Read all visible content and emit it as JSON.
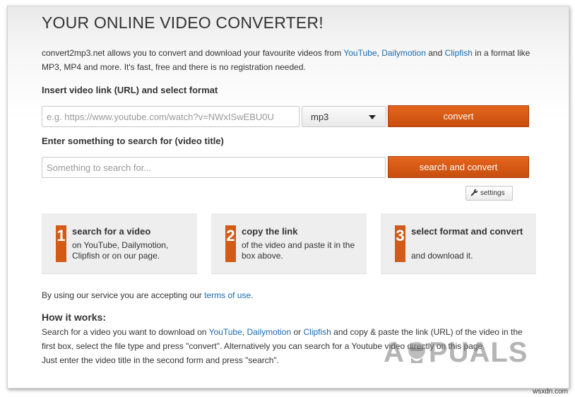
{
  "header": {
    "title": "YOUR ONLINE VIDEO CONVERTER!"
  },
  "intro": {
    "text1": "convert2mp3.net allows you to convert and download your favourite videos from ",
    "link1": "YouTube",
    "sep1": ", ",
    "link2": "Dailymotion",
    "sep2": " and ",
    "link3": "Clipfish",
    "text2": " in a format like MP3, MP4 and more. It's fast, free and there is no registration needed."
  },
  "url_form": {
    "label": "Insert video link (URL) and select format",
    "placeholder": "e.g. https://www.youtube.com/watch?v=NWxISwEBU0U",
    "format_value": "mp3",
    "convert_label": "convert"
  },
  "search_form": {
    "label": "Enter something to search for (video title)",
    "placeholder": "Something to search for...",
    "button_label": "search and convert"
  },
  "settings": {
    "label": "settings",
    "icon": "wrench-icon"
  },
  "steps": [
    {
      "number": "1",
      "title": "search for a video",
      "desc": "on YouTube, Dailymotion, Clipfish or on our page."
    },
    {
      "number": "2",
      "title": "copy the link",
      "desc": "of the video and paste it in the box above."
    },
    {
      "number": "3",
      "title": "select format and convert",
      "desc": "and download it."
    }
  ],
  "terms": {
    "text": "By using our service you are accepting our ",
    "link": "terms of use",
    "end": "."
  },
  "how": {
    "title": "How it works:",
    "t1": "Search for a video you want to download on ",
    "l1": "YouTube",
    "s1": ", ",
    "l2": "Dailymotion",
    "s2": " or ",
    "l3": "Clipfish",
    "t2": " and copy & paste the link (URL) of the video in the first box, select the file type and press \"convert\". Alternatively you can search for a Youtube video directly on this page.",
    "t3": "Just enter the video title in the second form and press \"search\"."
  },
  "watermark": {
    "left": "A",
    "right": "PUALS"
  },
  "footer": {
    "site": "wsxdn.com"
  },
  "colors": {
    "accent": "#d35b15",
    "link": "#1a6ab0",
    "box_bg": "#eeeeee"
  }
}
